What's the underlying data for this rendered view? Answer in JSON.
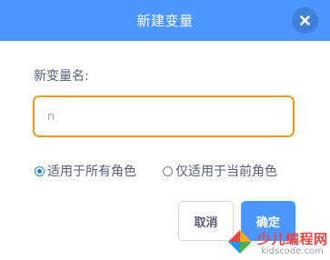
{
  "dialog": {
    "title": "新建变量",
    "close_icon": "close-icon",
    "colors": {
      "header": "#4c97ff",
      "input_focus_border": "#e6a01a",
      "ok_button": "#4c97ff",
      "radio_checked": "#2e7de0"
    }
  },
  "form": {
    "name_label": "新变量名:",
    "name_input": {
      "value": "",
      "placeholder": "n"
    },
    "scope_options": [
      {
        "label": "适用于所有角色",
        "checked": true
      },
      {
        "label": "仅适用于当前角色",
        "checked": false
      }
    ]
  },
  "buttons": {
    "cancel_label": "取消",
    "ok_label": "确定"
  },
  "watermark": {
    "logo_text": "少儿编程网",
    "domain_text": "kidscode.com"
  }
}
